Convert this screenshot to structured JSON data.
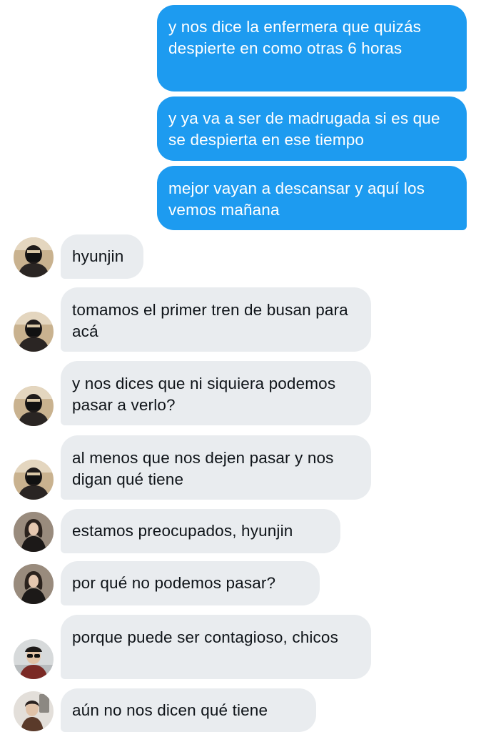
{
  "conversation": {
    "sent": [
      {
        "text": "y nos dice la enfermera que quizás despierte en como otras 6 horas"
      },
      {
        "text": "y ya va a ser de madrugada si es que se despierta en ese tiempo"
      },
      {
        "text": "mejor vayan a descansar y aquí los vemos mañana"
      }
    ],
    "received": [
      {
        "text": "hyunjin",
        "avatar": "masked-person-avatar"
      },
      {
        "text": "tomamos el primer tren de busan para acá",
        "avatar": "masked-person-avatar"
      },
      {
        "text": "y nos dices que ni siquiera podemos pasar a verlo?",
        "avatar": "masked-person-avatar"
      },
      {
        "text": "al menos que nos dejen pasar y nos digan qué tiene",
        "avatar": "masked-person-avatar"
      },
      {
        "text": "estamos preocupados, hyunjin",
        "avatar": "long-hair-person-avatar"
      },
      {
        "text": "por qué no podemos pasar?",
        "avatar": "long-hair-person-avatar"
      },
      {
        "text": "porque puede ser contagioso, chicos",
        "avatar": "sunglasses-person-avatar"
      },
      {
        "text": "aún no nos dicen qué tiene",
        "avatar": "mirror-selfie-avatar"
      }
    ]
  },
  "colors": {
    "sent_bubble": "#1d9bf0",
    "received_bubble": "#e9ecef",
    "sent_text": "#ffffff",
    "received_text": "#0f1419",
    "background": "#ffffff"
  }
}
